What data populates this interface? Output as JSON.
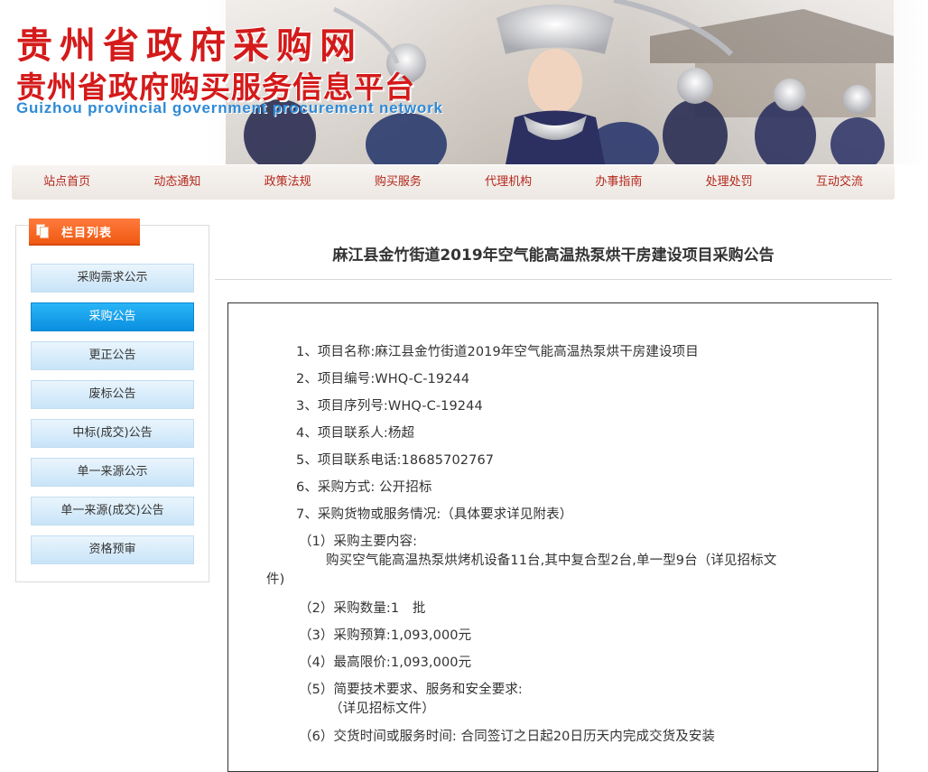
{
  "header": {
    "title_cn": "贵州省政府采购网",
    "subtitle_cn": "贵州省政府购买服务信息平台",
    "title_en": "Guizhou provincial government procurement network"
  },
  "nav": [
    "站点首页",
    "动态通知",
    "政策法规",
    "购买服务",
    "代理机构",
    "办事指南",
    "处理处罚",
    "互动交流"
  ],
  "sidebar": {
    "heading": "栏目列表",
    "active_index": 1,
    "items": [
      "采购需求公示",
      "采购公告",
      "更正公告",
      "废标公告",
      "中标(成交)公告",
      "单一来源公示",
      "单一来源(成交)公告",
      "资格预审"
    ]
  },
  "article": {
    "title": "麻江县金竹街道2019年空气能高温热泵烘干房建设项目采购公告",
    "lines": [
      "1、项目名称:麻江县金竹街道2019年空气能高温热泵烘干房建设项目",
      "2、项目编号:WHQ-C-19244",
      "3、项目序列号:WHQ-C-19244",
      "4、项目联系人:杨超",
      "5、项目联系电话:18685702767",
      "6、采购方式: 公开招标",
      "7、采购货物或服务情况:（具体要求详见附表）",
      "（1）采购主要内容:",
      "购买空气能高温热泵烘烤机设备11台,其中复合型2台,单一型9台（详见招标文",
      "件)",
      "（2）采购数量:1　批",
      "（3）采购预算:1,093,000元",
      "（4）最高限价:1,093,000元",
      "（5）简要技术要求、服务和安全要求:",
      "（详见招标文件）",
      "（6）交货时间或服务时间: 合同签订之日起20日历天内完成交货及安装"
    ]
  },
  "colors": {
    "brand_red": "#d41a1a",
    "nav_text": "#b4271b",
    "english_blue": "#2f8ad6",
    "sidebar_active": "#0a8fe0",
    "sidebar_heading": "#f05a12"
  }
}
